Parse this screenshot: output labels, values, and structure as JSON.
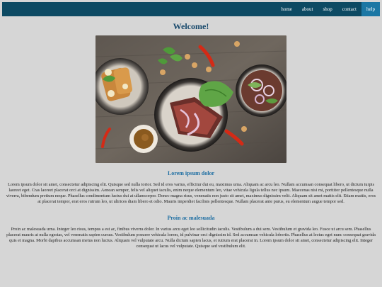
{
  "nav": {
    "items": [
      {
        "label": "home"
      },
      {
        "label": "about"
      },
      {
        "label": "shop"
      },
      {
        "label": "contact"
      },
      {
        "label": "help"
      }
    ],
    "active_index": 4
  },
  "welcome": "Welcome!",
  "hero_image": {
    "description_icon": "food-photo"
  },
  "section1": {
    "title": "Lorem ipsum dolor",
    "body": "Lorem ipsum dolor sit amet, consectetur adipiscing elit. Quisque sed nulla tortor. Sed id eros varius, efficitur dui eu, maximus urna. Aliquam ac arcu leo. Nullam accumsan consequat libero, ut dictum turpis laoreet eget. Cras laoreet placerat orci at dignissim. Aenean semper, felis vel aliquet iaculis, enim neque elementum leo, vitae vehicula ligula tellus nec ipsum. Maecenas nisi mi, porttitor pellentesque nulla viverra, bibendum pretium neque. Phasellus condimentum luctus dui at ullamcorper. Donec magna risus, venenatis non justo sit amet, maximus dignissim velit. Aliquam sit amet mattis elit. Etiam mattis, eros at placerat tempor, erat eros rutrum leo, ut ultrices diam libero et odio. Mauris imperdiet facilisis pellentesque. Nullam placerat ante purus, eu elementum augue tempor sed."
  },
  "section2": {
    "title": "Proin ac malesuada",
    "body": "Proin ac malesuada urna. Integer leo risus, tempus a est ac, finibus viverra dolor. In varius arcu eget leo sollicitudin iaculis. Vestibulum a dui sem. Vestibulum et gravida leo. Fusce ut arcu sem. Phasellus placerat mauris at nulla egestas, vel venenatis sapien cursus. Vestibulum posuere vehicula lorem, id pulvinar orci dignissim id. Sed accumsan vehicula lobortis. Phasellus at lectus eget nunc consequat gravida quis et magna. Morbi dapibus accumsan metus non luctus. Aliquam vel vulputate arcu. Nulla dictum sapien lacus, et rutrum erat placerat in. Lorem ipsum dolor sit amet, consectetur adipiscing elit. Integer consequat ut lacus vel vulputate. Quisque sed vestibulum elit."
  }
}
